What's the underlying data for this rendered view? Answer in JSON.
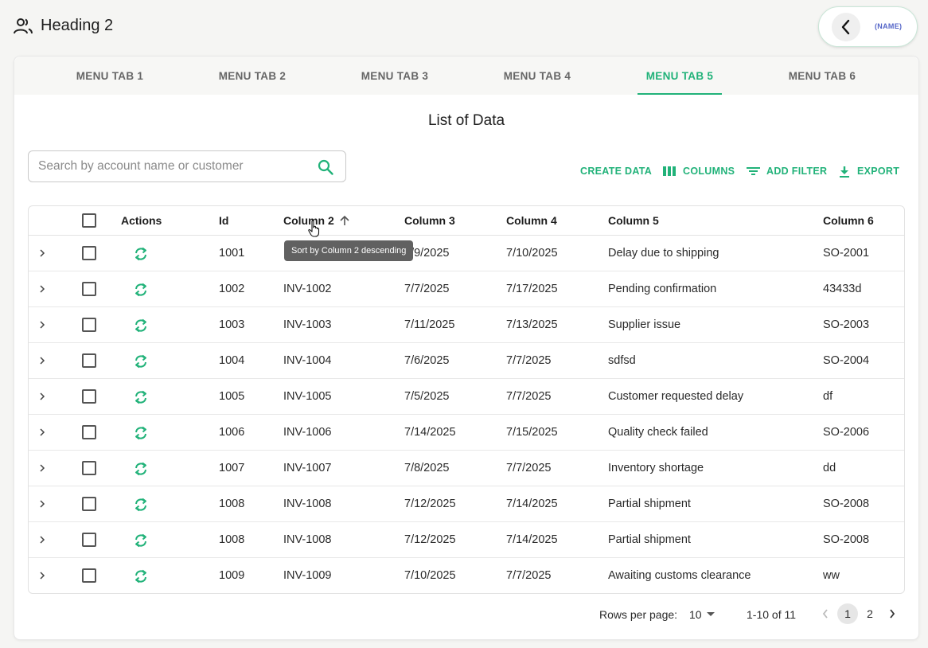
{
  "header": {
    "title": "Heading 2",
    "user_name": "(NAME)"
  },
  "tabs": [
    {
      "label": "MENU TAB 1",
      "active": false
    },
    {
      "label": "MENU TAB 2",
      "active": false
    },
    {
      "label": "MENU TAB 3",
      "active": false
    },
    {
      "label": "MENU TAB 4",
      "active": false
    },
    {
      "label": "MENU TAB 5",
      "active": true
    },
    {
      "label": "MENU TAB 6",
      "active": false
    }
  ],
  "main": {
    "title": "List of Data",
    "search": {
      "placeholder": "Search by account name or customer",
      "value": ""
    },
    "toolbar": {
      "create_label": "CREATE DATA",
      "columns_label": "COLUMNS",
      "filter_label": "ADD FILTER",
      "export_label": "EXPORT"
    }
  },
  "table": {
    "columns": [
      "Actions",
      "Id",
      "Column 2",
      "Column 3",
      "Column 4",
      "Column 5",
      "Column 6"
    ],
    "sort": {
      "column": "Column 2",
      "direction": "ascending"
    },
    "tooltip": "Sort by Column 2 descending",
    "rows": [
      {
        "id": "1001",
        "c2": "INV-1001",
        "c3": "7/9/2025",
        "c4": "7/10/2025",
        "c5": "Delay due to shipping",
        "c6": "SO-2001"
      },
      {
        "id": "1002",
        "c2": "INV-1002",
        "c3": "7/7/2025",
        "c4": "7/17/2025",
        "c5": "Pending confirmation",
        "c6": "43433d"
      },
      {
        "id": "1003",
        "c2": "INV-1003",
        "c3": "7/11/2025",
        "c4": "7/13/2025",
        "c5": "Supplier issue",
        "c6": "SO-2003"
      },
      {
        "id": "1004",
        "c2": "INV-1004",
        "c3": "7/6/2025",
        "c4": "7/7/2025",
        "c5": "sdfsd",
        "c6": "SO-2004"
      },
      {
        "id": "1005",
        "c2": "INV-1005",
        "c3": "7/5/2025",
        "c4": "7/7/2025",
        "c5": "Customer requested delay",
        "c6": "df"
      },
      {
        "id": "1006",
        "c2": "INV-1006",
        "c3": "7/14/2025",
        "c4": "7/15/2025",
        "c5": "Quality check failed",
        "c6": "SO-2006"
      },
      {
        "id": "1007",
        "c2": "INV-1007",
        "c3": "7/8/2025",
        "c4": "7/7/2025",
        "c5": "Inventory shortage",
        "c6": "dd"
      },
      {
        "id": "1008",
        "c2": "INV-1008",
        "c3": "7/12/2025",
        "c4": "7/14/2025",
        "c5": "Partial shipment",
        "c6": "SO-2008"
      },
      {
        "id": "1008",
        "c2": "INV-1008",
        "c3": "7/12/2025",
        "c4": "7/14/2025",
        "c5": "Partial shipment",
        "c6": "SO-2008"
      },
      {
        "id": "1009",
        "c2": "INV-1009",
        "c3": "7/10/2025",
        "c4": "7/7/2025",
        "c5": "Awaiting customs clearance",
        "c6": "ww"
      }
    ]
  },
  "pagination": {
    "rows_per_page_label": "Rows per page:",
    "rows_per_page": "10",
    "range": "1-10 of 11",
    "pages": [
      "1",
      "2"
    ],
    "current_page": "1"
  },
  "colors": {
    "accent": "#21b279",
    "tooltip_bg": "#616161",
    "user_name": "#5566c8"
  },
  "icons": [
    "people-icon",
    "back-arrow-icon",
    "search-icon",
    "columns-icon",
    "filter-icon",
    "download-icon",
    "sort-arrow-up-icon",
    "sync-icon",
    "chevron-right-icon",
    "dropdown-arrow-icon",
    "chevron-left-icon",
    "cursor-hand-icon"
  ]
}
